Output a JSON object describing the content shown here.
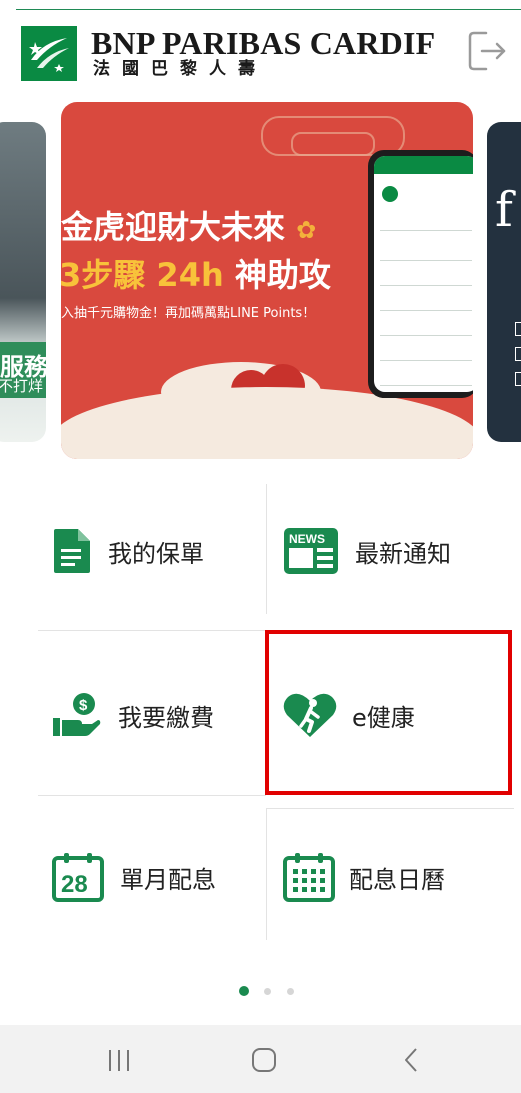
{
  "header": {
    "brand_name": "BNP PARIBAS CARDIF",
    "brand_sub": "法國巴黎人壽",
    "logout_icon": "logout-icon",
    "brand_color": "#0a8a43"
  },
  "carousel": {
    "main_slide": {
      "line1": "金虎迎財大未來",
      "line2_prefix": "3步驟",
      "line2_highlight": "24h",
      "line2_suffix": "神助攻",
      "line3": "入抽千元購物金！再加碼萬點LINE Points！"
    },
    "left_slide": {
      "text1": "服務",
      "text2": "不打烊"
    },
    "right_slide": {
      "text": "f"
    },
    "active_index": 0,
    "page_count": 3
  },
  "menu": {
    "items": [
      {
        "label": "我的保單",
        "icon": "policy-document-icon"
      },
      {
        "label": "最新通知",
        "icon": "news-icon"
      },
      {
        "label": "我要繳費",
        "icon": "payment-hand-icon"
      },
      {
        "label": "e健康",
        "icon": "health-heart-walking-icon"
      },
      {
        "label": "單月配息",
        "icon": "calendar-28-icon"
      },
      {
        "label": "配息日曆",
        "icon": "calendar-grid-icon"
      }
    ],
    "highlighted_item": "e健康",
    "highlight_color": "#e10000",
    "icon_color": "#1a8a4f"
  },
  "navbar": {
    "recent_icon": "recent-apps-icon",
    "home_icon": "home-icon",
    "back_icon": "back-icon"
  }
}
